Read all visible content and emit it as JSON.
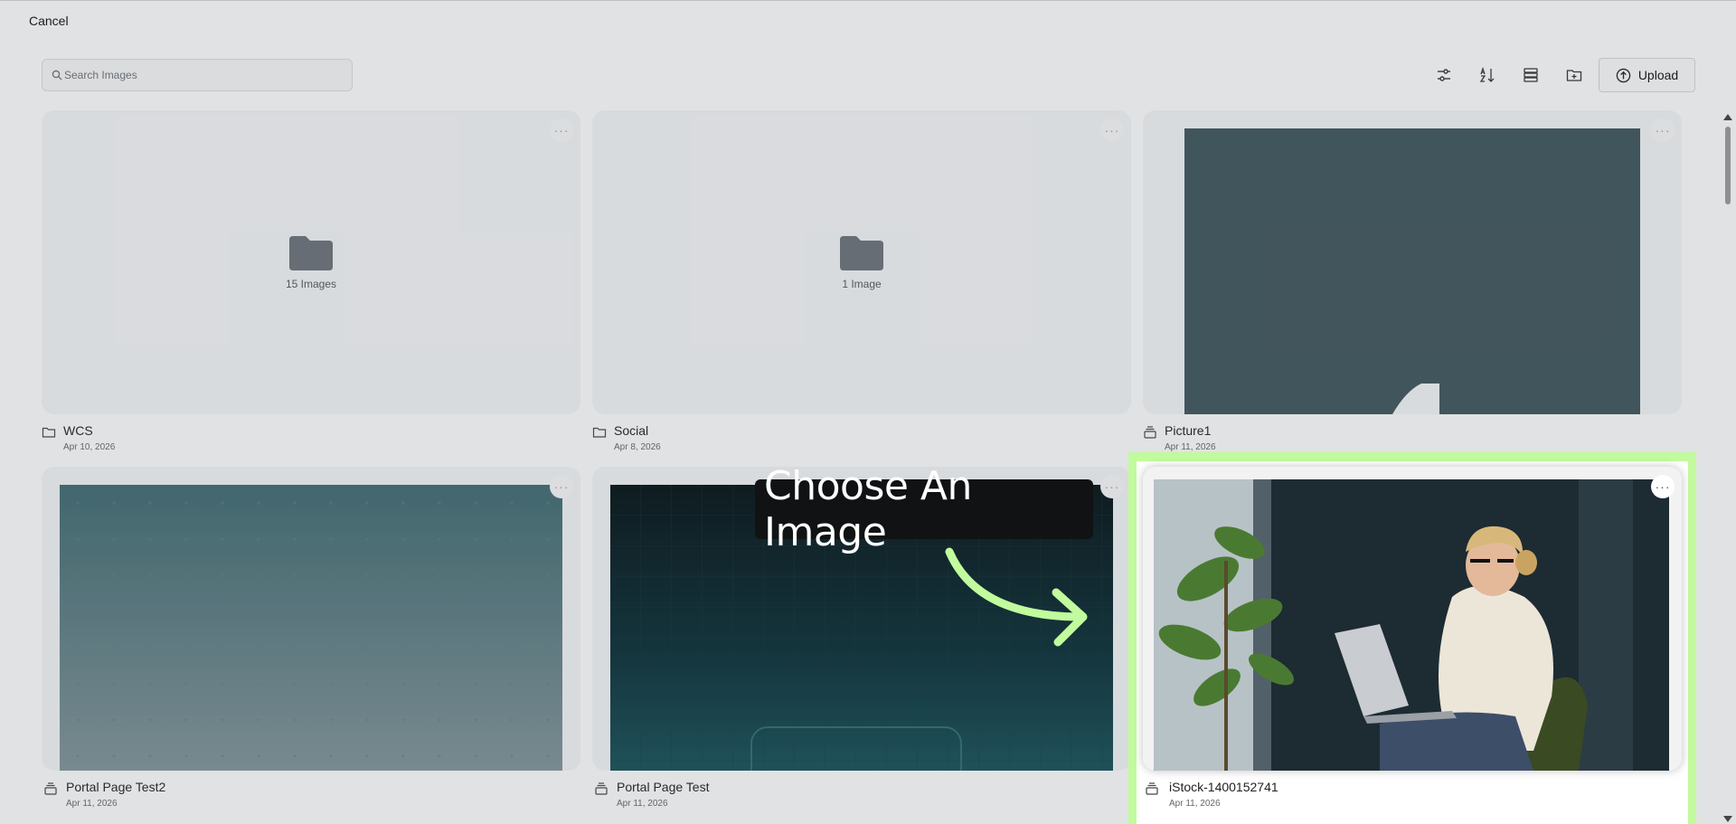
{
  "header": {
    "cancel_label": "Cancel"
  },
  "search": {
    "placeholder": "Search Images"
  },
  "toolbar": {
    "upload_label": "Upload"
  },
  "items": [
    {
      "type": "folder",
      "name": "WCS",
      "date": "Apr 10, 2026",
      "count": "15 Images"
    },
    {
      "type": "folder",
      "name": "Social",
      "date": "Apr 8, 2026",
      "count": "1 Image"
    },
    {
      "type": "image",
      "name": "Picture1",
      "date": "Apr 11, 2026"
    },
    {
      "type": "image",
      "name": "Portal Page Test2",
      "date": "Apr 11, 2026"
    },
    {
      "type": "image",
      "name": "Portal Page Test",
      "date": "Apr 11, 2026"
    },
    {
      "type": "image",
      "name": "iStock-1400152741",
      "date": "Apr 11, 2026"
    }
  ],
  "callout": {
    "text": "Choose An Image"
  },
  "colors": {
    "highlight": "#c1fb9d",
    "callout_bg": "#101214",
    "arrow": "#c1fb9d"
  }
}
